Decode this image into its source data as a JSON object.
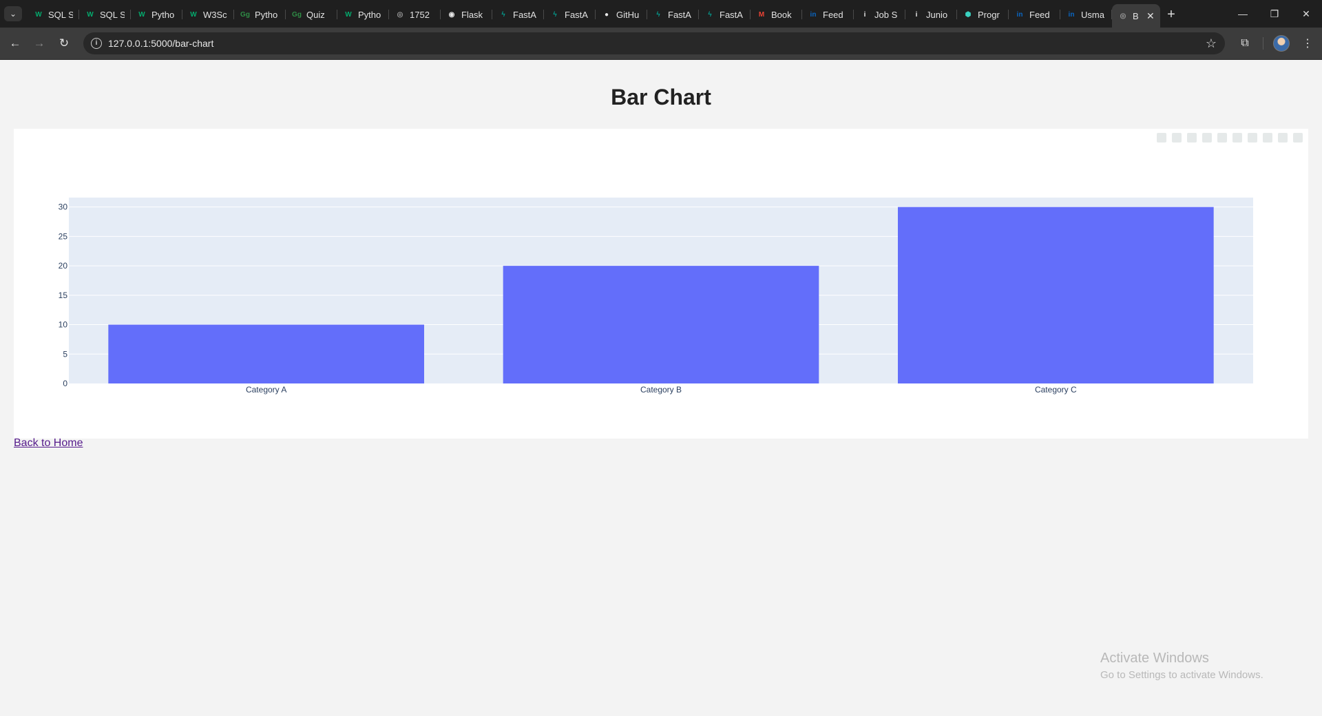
{
  "browser": {
    "tabs": [
      {
        "title": "SQL S",
        "icon": "w3schools-icon",
        "color": "#04aa6d",
        "glyph": "W"
      },
      {
        "title": "SQL S",
        "icon": "w3schools-icon",
        "color": "#04aa6d",
        "glyph": "W"
      },
      {
        "title": "Pytho",
        "icon": "w3schools-icon",
        "color": "#04aa6d",
        "glyph": "W"
      },
      {
        "title": "W3Sc",
        "icon": "w3schools-icon",
        "color": "#04aa6d",
        "glyph": "W"
      },
      {
        "title": "Pytho",
        "icon": "geeksforgeeks-icon",
        "color": "#2f8d46",
        "glyph": "Gg"
      },
      {
        "title": "Quiz",
        "icon": "geeksforgeeks-icon",
        "color": "#2f8d46",
        "glyph": "Gg"
      },
      {
        "title": "Pytho",
        "icon": "w3schools-icon",
        "color": "#04aa6d",
        "glyph": "W"
      },
      {
        "title": "1752",
        "icon": "globe-icon",
        "color": "#9a9a9a",
        "glyph": "◎"
      },
      {
        "title": "Flask",
        "icon": "flask-icon",
        "color": "#e8e8e8",
        "glyph": "◉"
      },
      {
        "title": "FastA",
        "icon": "fastapi-icon",
        "color": "#05998b",
        "glyph": "ϟ"
      },
      {
        "title": "FastA",
        "icon": "fastapi-icon",
        "color": "#05998b",
        "glyph": "ϟ"
      },
      {
        "title": "GitHu",
        "icon": "github-icon",
        "color": "#e8e8e8",
        "glyph": "●"
      },
      {
        "title": "FastA",
        "icon": "fastapi-icon",
        "color": "#05998b",
        "glyph": "ϟ"
      },
      {
        "title": "FastA",
        "icon": "fastapi-icon",
        "color": "#05998b",
        "glyph": "ϟ"
      },
      {
        "title": "Book",
        "icon": "gmail-icon",
        "color": "#ea4335",
        "glyph": "M"
      },
      {
        "title": "Feed",
        "icon": "linkedin-icon",
        "color": "#0a66c2",
        "glyph": "in"
      },
      {
        "title": "Job S",
        "icon": "info-icon",
        "color": "#e8e8e8",
        "glyph": "i"
      },
      {
        "title": "Junio",
        "icon": "info-icon",
        "color": "#e8e8e8",
        "glyph": "i"
      },
      {
        "title": "Progr",
        "icon": "shield-icon",
        "color": "#3ad1c0",
        "glyph": "⬢"
      },
      {
        "title": "Feed",
        "icon": "linkedin-icon",
        "color": "#0a66c2",
        "glyph": "in"
      },
      {
        "title": "Usma",
        "icon": "linkedin-icon",
        "color": "#0a66c2",
        "glyph": "in"
      }
    ],
    "active_tab": {
      "title": "B",
      "icon": "globe-icon"
    },
    "url": "127.0.0.1:5000/bar-chart"
  },
  "page": {
    "title": "Bar Chart",
    "back_link": "Back to Home"
  },
  "chart_data": {
    "type": "bar",
    "categories": [
      "Category A",
      "Category B",
      "Category C"
    ],
    "values": [
      10,
      20,
      30
    ],
    "title": "",
    "xlabel": "",
    "ylabel": "",
    "ylim": [
      0,
      31.6
    ],
    "yticks": [
      0,
      5,
      10,
      15,
      20,
      25,
      30
    ],
    "bar_color": "#636efa",
    "plot_bg": "#e5ecf6",
    "grid": true,
    "legend": "none"
  },
  "watermark": {
    "line1": "Activate Windows",
    "line2": "Go to Settings to activate Windows."
  }
}
